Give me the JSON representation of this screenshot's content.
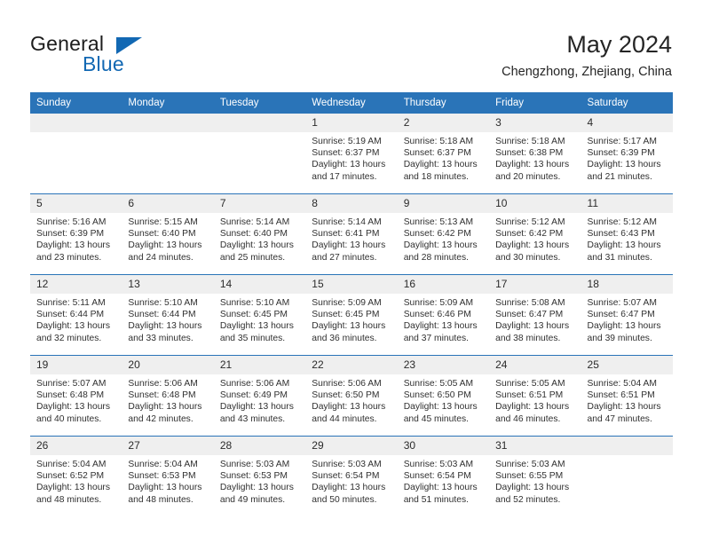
{
  "brand": {
    "word_one": "General",
    "word_two": "Blue",
    "triangle_icon": "brand-triangle-icon",
    "accent_color": "#1268b3"
  },
  "header": {
    "title": "May 2024",
    "subtitle": "Chengzhong, Zhejiang, China"
  },
  "theme": {
    "header_blue": "#2a74b8",
    "daynum_band": "#efefef",
    "text": "#303030"
  },
  "calendar": {
    "weekday_headers": [
      "Sunday",
      "Monday",
      "Tuesday",
      "Wednesday",
      "Thursday",
      "Friday",
      "Saturday"
    ],
    "weeks": [
      [
        {
          "day": "",
          "empty": true
        },
        {
          "day": "",
          "empty": true
        },
        {
          "day": "",
          "empty": true
        },
        {
          "day": "1",
          "sunrise": "Sunrise: 5:19 AM",
          "sunset": "Sunset: 6:37 PM",
          "daylight_line1": "Daylight: 13 hours",
          "daylight_line2": "and 17 minutes."
        },
        {
          "day": "2",
          "sunrise": "Sunrise: 5:18 AM",
          "sunset": "Sunset: 6:37 PM",
          "daylight_line1": "Daylight: 13 hours",
          "daylight_line2": "and 18 minutes."
        },
        {
          "day": "3",
          "sunrise": "Sunrise: 5:18 AM",
          "sunset": "Sunset: 6:38 PM",
          "daylight_line1": "Daylight: 13 hours",
          "daylight_line2": "and 20 minutes."
        },
        {
          "day": "4",
          "sunrise": "Sunrise: 5:17 AM",
          "sunset": "Sunset: 6:39 PM",
          "daylight_line1": "Daylight: 13 hours",
          "daylight_line2": "and 21 minutes."
        }
      ],
      [
        {
          "day": "5",
          "sunrise": "Sunrise: 5:16 AM",
          "sunset": "Sunset: 6:39 PM",
          "daylight_line1": "Daylight: 13 hours",
          "daylight_line2": "and 23 minutes."
        },
        {
          "day": "6",
          "sunrise": "Sunrise: 5:15 AM",
          "sunset": "Sunset: 6:40 PM",
          "daylight_line1": "Daylight: 13 hours",
          "daylight_line2": "and 24 minutes."
        },
        {
          "day": "7",
          "sunrise": "Sunrise: 5:14 AM",
          "sunset": "Sunset: 6:40 PM",
          "daylight_line1": "Daylight: 13 hours",
          "daylight_line2": "and 25 minutes."
        },
        {
          "day": "8",
          "sunrise": "Sunrise: 5:14 AM",
          "sunset": "Sunset: 6:41 PM",
          "daylight_line1": "Daylight: 13 hours",
          "daylight_line2": "and 27 minutes."
        },
        {
          "day": "9",
          "sunrise": "Sunrise: 5:13 AM",
          "sunset": "Sunset: 6:42 PM",
          "daylight_line1": "Daylight: 13 hours",
          "daylight_line2": "and 28 minutes."
        },
        {
          "day": "10",
          "sunrise": "Sunrise: 5:12 AM",
          "sunset": "Sunset: 6:42 PM",
          "daylight_line1": "Daylight: 13 hours",
          "daylight_line2": "and 30 minutes."
        },
        {
          "day": "11",
          "sunrise": "Sunrise: 5:12 AM",
          "sunset": "Sunset: 6:43 PM",
          "daylight_line1": "Daylight: 13 hours",
          "daylight_line2": "and 31 minutes."
        }
      ],
      [
        {
          "day": "12",
          "sunrise": "Sunrise: 5:11 AM",
          "sunset": "Sunset: 6:44 PM",
          "daylight_line1": "Daylight: 13 hours",
          "daylight_line2": "and 32 minutes."
        },
        {
          "day": "13",
          "sunrise": "Sunrise: 5:10 AM",
          "sunset": "Sunset: 6:44 PM",
          "daylight_line1": "Daylight: 13 hours",
          "daylight_line2": "and 33 minutes."
        },
        {
          "day": "14",
          "sunrise": "Sunrise: 5:10 AM",
          "sunset": "Sunset: 6:45 PM",
          "daylight_line1": "Daylight: 13 hours",
          "daylight_line2": "and 35 minutes."
        },
        {
          "day": "15",
          "sunrise": "Sunrise: 5:09 AM",
          "sunset": "Sunset: 6:45 PM",
          "daylight_line1": "Daylight: 13 hours",
          "daylight_line2": "and 36 minutes."
        },
        {
          "day": "16",
          "sunrise": "Sunrise: 5:09 AM",
          "sunset": "Sunset: 6:46 PM",
          "daylight_line1": "Daylight: 13 hours",
          "daylight_line2": "and 37 minutes."
        },
        {
          "day": "17",
          "sunrise": "Sunrise: 5:08 AM",
          "sunset": "Sunset: 6:47 PM",
          "daylight_line1": "Daylight: 13 hours",
          "daylight_line2": "and 38 minutes."
        },
        {
          "day": "18",
          "sunrise": "Sunrise: 5:07 AM",
          "sunset": "Sunset: 6:47 PM",
          "daylight_line1": "Daylight: 13 hours",
          "daylight_line2": "and 39 minutes."
        }
      ],
      [
        {
          "day": "19",
          "sunrise": "Sunrise: 5:07 AM",
          "sunset": "Sunset: 6:48 PM",
          "daylight_line1": "Daylight: 13 hours",
          "daylight_line2": "and 40 minutes."
        },
        {
          "day": "20",
          "sunrise": "Sunrise: 5:06 AM",
          "sunset": "Sunset: 6:48 PM",
          "daylight_line1": "Daylight: 13 hours",
          "daylight_line2": "and 42 minutes."
        },
        {
          "day": "21",
          "sunrise": "Sunrise: 5:06 AM",
          "sunset": "Sunset: 6:49 PM",
          "daylight_line1": "Daylight: 13 hours",
          "daylight_line2": "and 43 minutes."
        },
        {
          "day": "22",
          "sunrise": "Sunrise: 5:06 AM",
          "sunset": "Sunset: 6:50 PM",
          "daylight_line1": "Daylight: 13 hours",
          "daylight_line2": "and 44 minutes."
        },
        {
          "day": "23",
          "sunrise": "Sunrise: 5:05 AM",
          "sunset": "Sunset: 6:50 PM",
          "daylight_line1": "Daylight: 13 hours",
          "daylight_line2": "and 45 minutes."
        },
        {
          "day": "24",
          "sunrise": "Sunrise: 5:05 AM",
          "sunset": "Sunset: 6:51 PM",
          "daylight_line1": "Daylight: 13 hours",
          "daylight_line2": "and 46 minutes."
        },
        {
          "day": "25",
          "sunrise": "Sunrise: 5:04 AM",
          "sunset": "Sunset: 6:51 PM",
          "daylight_line1": "Daylight: 13 hours",
          "daylight_line2": "and 47 minutes."
        }
      ],
      [
        {
          "day": "26",
          "sunrise": "Sunrise: 5:04 AM",
          "sunset": "Sunset: 6:52 PM",
          "daylight_line1": "Daylight: 13 hours",
          "daylight_line2": "and 48 minutes."
        },
        {
          "day": "27",
          "sunrise": "Sunrise: 5:04 AM",
          "sunset": "Sunset: 6:53 PM",
          "daylight_line1": "Daylight: 13 hours",
          "daylight_line2": "and 48 minutes."
        },
        {
          "day": "28",
          "sunrise": "Sunrise: 5:03 AM",
          "sunset": "Sunset: 6:53 PM",
          "daylight_line1": "Daylight: 13 hours",
          "daylight_line2": "and 49 minutes."
        },
        {
          "day": "29",
          "sunrise": "Sunrise: 5:03 AM",
          "sunset": "Sunset: 6:54 PM",
          "daylight_line1": "Daylight: 13 hours",
          "daylight_line2": "and 50 minutes."
        },
        {
          "day": "30",
          "sunrise": "Sunrise: 5:03 AM",
          "sunset": "Sunset: 6:54 PM",
          "daylight_line1": "Daylight: 13 hours",
          "daylight_line2": "and 51 minutes."
        },
        {
          "day": "31",
          "sunrise": "Sunrise: 5:03 AM",
          "sunset": "Sunset: 6:55 PM",
          "daylight_line1": "Daylight: 13 hours",
          "daylight_line2": "and 52 minutes."
        },
        {
          "day": "",
          "empty": true
        }
      ]
    ]
  }
}
